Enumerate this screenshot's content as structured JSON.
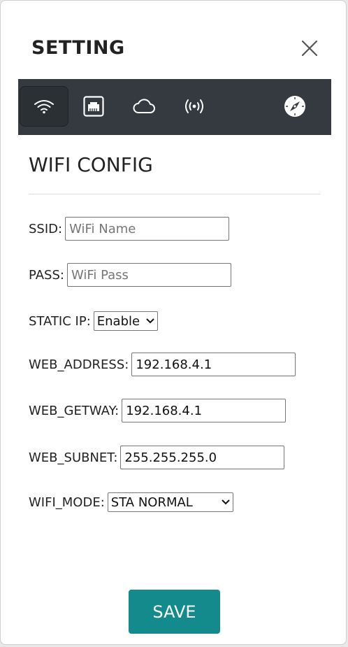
{
  "dialog": {
    "title": "SETTING",
    "close_icon": "close-icon"
  },
  "tabs": [
    {
      "icon": "wifi-icon",
      "active": true
    },
    {
      "icon": "ethernet-icon",
      "active": false
    },
    {
      "icon": "cloud-icon",
      "active": false
    },
    {
      "icon": "broadcast-icon",
      "active": false
    },
    {
      "icon": "compass-icon",
      "active": false
    }
  ],
  "section": {
    "title": "WIFI CONFIG"
  },
  "form": {
    "ssid": {
      "label": "SSID:",
      "value": "",
      "placeholder": "WiFi Name"
    },
    "pass": {
      "label": "PASS:",
      "value": "",
      "placeholder": "WiFi Pass"
    },
    "static_ip": {
      "label": "STATIC IP:",
      "selected": "Enable"
    },
    "web_address": {
      "label": "WEB_ADDRESS:",
      "value": "192.168.4.1"
    },
    "web_getway": {
      "label": "WEB_GETWAY:",
      "value": "192.168.4.1"
    },
    "web_subnet": {
      "label": "WEB_SUBNET:",
      "value": "255.255.255.0"
    },
    "wifi_mode": {
      "label": "WIFI_MODE:",
      "selected": "STA NORMAL"
    }
  },
  "actions": {
    "save_label": "SAVE"
  },
  "colors": {
    "navbar": "#343a40",
    "save_button": "#138a8c",
    "icon": "#ffffff"
  }
}
